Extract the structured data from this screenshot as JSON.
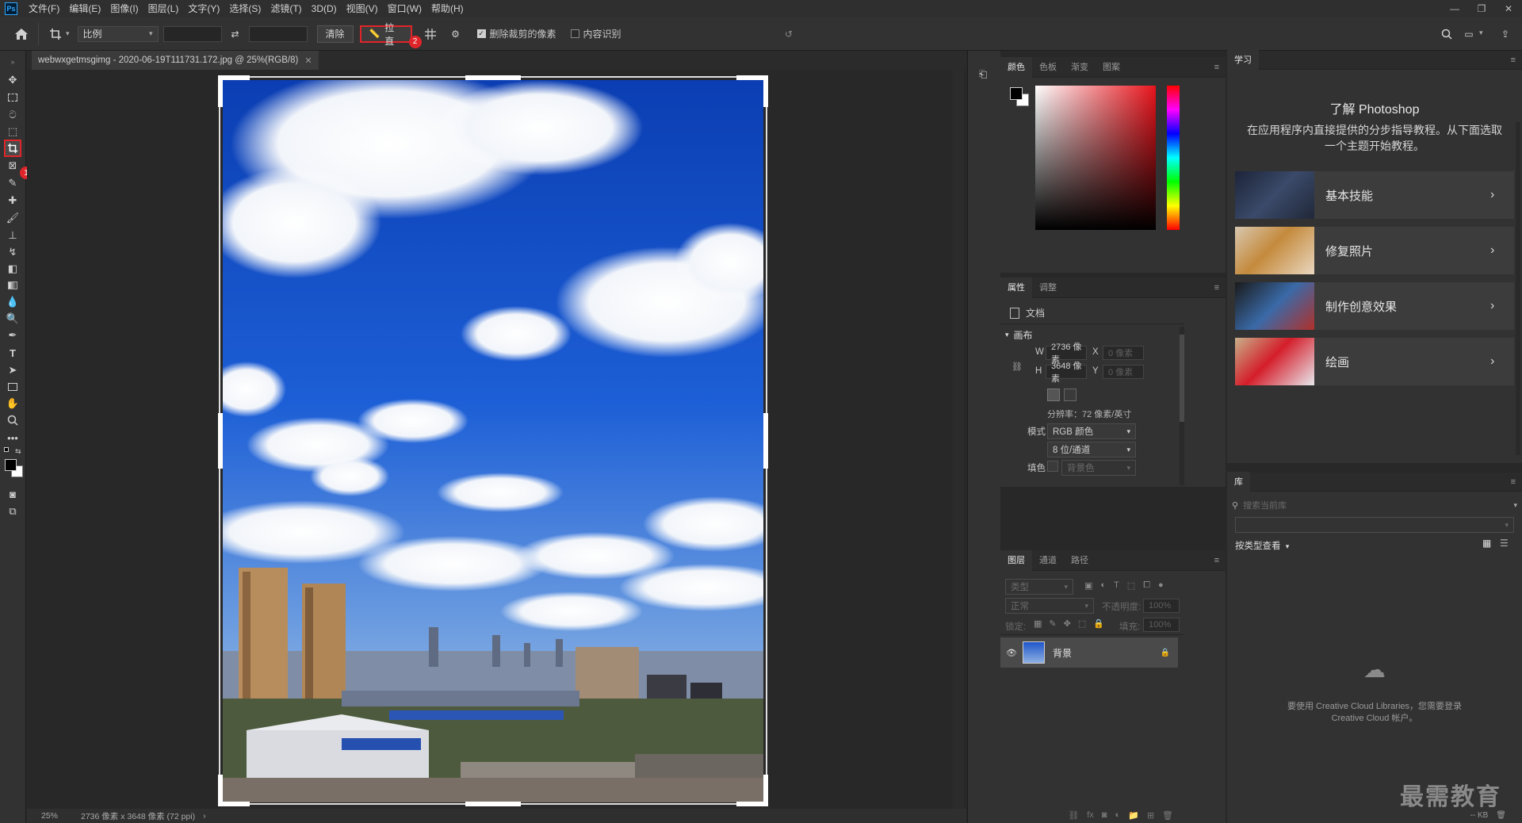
{
  "menu": {
    "logo": "Ps",
    "items": [
      "文件(F)",
      "编辑(E)",
      "图像(I)",
      "图层(L)",
      "文字(Y)",
      "选择(S)",
      "滤镜(T)",
      "3D(D)",
      "视图(V)",
      "窗口(W)",
      "帮助(H)"
    ]
  },
  "options": {
    "ratio_select": "比例",
    "clear_button": "清除",
    "straighten_button": "拉直",
    "delete_cropped_label": "删除裁剪的像素",
    "content_aware_label": "内容识别",
    "badge_1": "1",
    "badge_2": "2"
  },
  "document": {
    "tab_title": "webwxgetmsgimg - 2020-06-19T111731.172.jpg @ 25%(RGB/8)",
    "zoom": "25%",
    "status": "2736 像素 x 3648 像素 (72 ppi)"
  },
  "color_panel": {
    "tabs": [
      "颜色",
      "色板",
      "渐变",
      "图案"
    ]
  },
  "properties_panel": {
    "tabs": [
      "属性",
      "调整"
    ],
    "doc_label": "文档",
    "canvas_section": "画布",
    "w_label": "W",
    "w_value": "2736 像素",
    "h_label": "H",
    "h_value": "3648 像素",
    "x_label": "X",
    "x_placeholder": "0 像素",
    "y_label": "Y",
    "y_placeholder": "0 像素",
    "resolution": "分辨率：72 像素/英寸",
    "mode_label": "模式",
    "mode_value": "RGB 颜色",
    "depth_value": "8 位/通道",
    "fill_label": "填色",
    "fill_value": "背景色"
  },
  "layers_panel": {
    "tabs": [
      "图层",
      "通道",
      "路径"
    ],
    "kind_placeholder": "类型",
    "blend_mode": "正常",
    "opacity_label": "不透明度:",
    "opacity_value": "100%",
    "lock_label": "锁定:",
    "fill_label": "填充:",
    "fill_value": "100%",
    "layer_name": "背景"
  },
  "learn_panel": {
    "tab": "学习",
    "heading": "了解 Photoshop",
    "description": "在应用程序内直接提供的分步指导教程。从下面选取一个主题开始教程。",
    "items": [
      {
        "label": "基本技能"
      },
      {
        "label": "修复照片"
      },
      {
        "label": "制作创意效果"
      },
      {
        "label": "绘画"
      }
    ]
  },
  "library_panel": {
    "tab": "库",
    "search_placeholder": "搜索当前库",
    "view_by": "按类型查看",
    "message": "要使用 Creative Cloud Libraries，您需要登录 Creative Cloud 帐户。",
    "size": "-- KB"
  },
  "watermark": "最需教育"
}
